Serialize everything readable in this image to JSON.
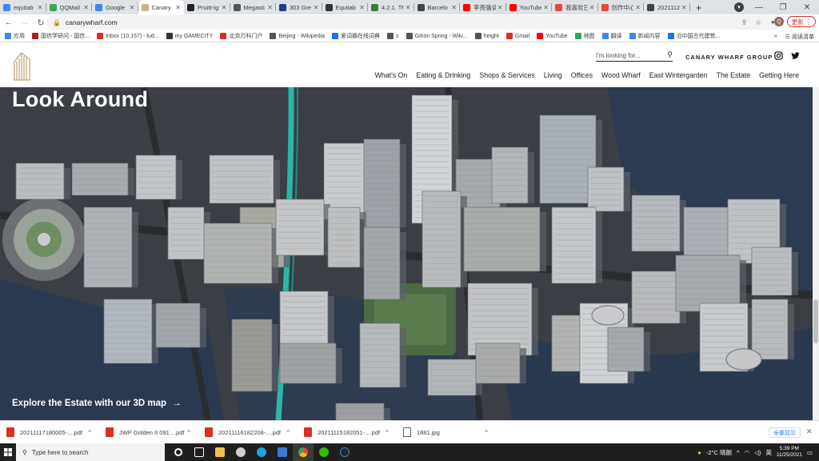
{
  "tabs": [
    {
      "label": "equitab",
      "color": "#4285f4"
    },
    {
      "label": "QQMail",
      "color": "#34a853"
    },
    {
      "label": "Google",
      "color": "#4285f4"
    },
    {
      "label": "Canary",
      "color": "#c9b28a",
      "active": true
    },
    {
      "label": "Pruitt-Ig",
      "color": "#222222"
    },
    {
      "label": "Megasti",
      "color": "#555555"
    },
    {
      "label": "303 Gre",
      "color": "#1a3e8a"
    },
    {
      "label": "Equitab",
      "color": "#333333"
    },
    {
      "label": "4.2.1. Th",
      "color": "#3c7a3c"
    },
    {
      "label": "Barcelo",
      "color": "#444444"
    },
    {
      "label": "李亮強谈",
      "color": "#ff0000"
    },
    {
      "label": "YouTube",
      "color": "#ff0000"
    },
    {
      "label": "我喜欢日",
      "color": "#e8453c"
    },
    {
      "label": "创作中心",
      "color": "#e8453c"
    },
    {
      "label": "2021112",
      "color": "#444444"
    }
  ],
  "toolbar": {
    "url": "canarywharf.com",
    "profile_initial": "Q",
    "update_label": "更新"
  },
  "bookmarks": [
    {
      "label": "应用",
      "color": "#4285f4"
    },
    {
      "label": "国信学研问 - 国信...",
      "color": "#b31b1b"
    },
    {
      "label": "Inbox (10,157) - lud...",
      "color": "#d93025"
    },
    {
      "label": "my GAMECITY",
      "color": "#333333"
    },
    {
      "label": "北京万科门户",
      "color": "#d93025"
    },
    {
      "label": "Beijing - Wikipedia",
      "color": "#555555"
    },
    {
      "label": "爱词霸在线词典",
      "color": "#1a73e8"
    },
    {
      "label": "s",
      "color": "#555555"
    },
    {
      "label": "Gihon Spring - Wiki...",
      "color": "#555555"
    },
    {
      "label": "height",
      "color": "#555555"
    },
    {
      "label": "Gmail",
      "color": "#d93025"
    },
    {
      "label": "YouTube",
      "color": "#ff0000"
    },
    {
      "label": "地图",
      "color": "#34a853"
    },
    {
      "label": "翻译",
      "color": "#4285f4"
    },
    {
      "label": "新闻内容",
      "color": "#4285f4"
    },
    {
      "label": "沿中国古代建筑...",
      "color": "#1a73e8"
    }
  ],
  "bookmarks_more": "»",
  "reading_list": "阅读清单",
  "site": {
    "search_placeholder": "I'm looking for...",
    "group_label": "CANARY WHARF GROUP",
    "nav": [
      "What's On",
      "Eating & Drinking",
      "Shops & Services",
      "Living",
      "Offices",
      "Wood Wharf",
      "East Wintergarden",
      "The Estate",
      "Getting Here"
    ],
    "hero_title": "Look Around",
    "hero_cta": "Explore the Estate with our 3D map",
    "hero_cta_arrow": "→"
  },
  "downloads": [
    {
      "name": "20211117180005-....pdf",
      "type": "pdf"
    },
    {
      "name": "JWP Golden II 091....pdf",
      "type": "pdf"
    },
    {
      "name": "20211116182208-....pdf",
      "type": "pdf"
    },
    {
      "name": "20211115182051-....pdf",
      "type": "pdf"
    },
    {
      "name": "1881.jpg",
      "type": "img"
    }
  ],
  "downloads_show_all": "全部显示",
  "taskbar": {
    "search_placeholder": "Type here to search",
    "weather": "-2°C 晴朗",
    "time": "5:39 PM",
    "date": "11/25/2021",
    "lang": "英"
  },
  "colors": {
    "accent_red": "#d93025",
    "brand_gold": "#c9b28a",
    "water": "#2c3a52"
  }
}
